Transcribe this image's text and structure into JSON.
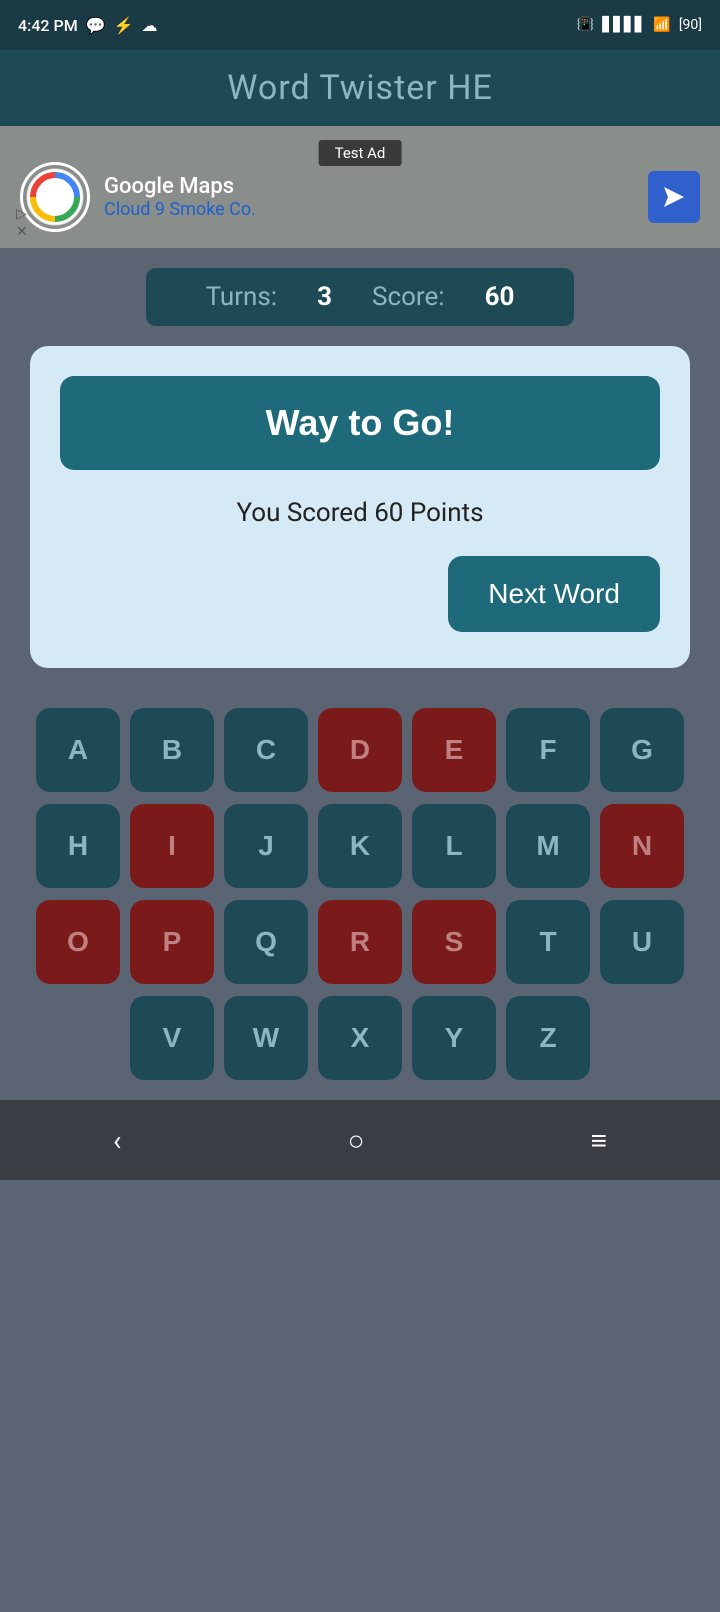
{
  "statusBar": {
    "time": "4:42 PM",
    "battery": "90"
  },
  "header": {
    "title": "Word Twister HE"
  },
  "ad": {
    "label": "Test Ad",
    "company": "Google Maps",
    "subtitle": "Cloud 9 Smoke Co."
  },
  "scorePanel": {
    "turnsLabel": "Turns:",
    "turnsValue": "3",
    "scoreLabel": "Score:",
    "scoreValue": "60"
  },
  "modal": {
    "wayToGoLabel": "Way to Go!",
    "scoredText": "You Scored 60 Points",
    "nextWordLabel": "Next Word"
  },
  "keyboard": {
    "rows": [
      [
        "A",
        "B",
        "C",
        "D",
        "E",
        "F",
        "G"
      ],
      [
        "H",
        "I",
        "J",
        "K",
        "L",
        "M",
        "N"
      ],
      [
        "O",
        "P",
        "Q",
        "R",
        "S",
        "T",
        "U"
      ],
      [
        "V",
        "W",
        "X",
        "Y",
        "Z"
      ]
    ],
    "usedKeys": [
      "D",
      "E",
      "I",
      "N",
      "O",
      "P",
      "R",
      "S"
    ]
  },
  "navBar": {
    "backLabel": "‹",
    "homeLabel": "○",
    "menuLabel": "≡"
  }
}
